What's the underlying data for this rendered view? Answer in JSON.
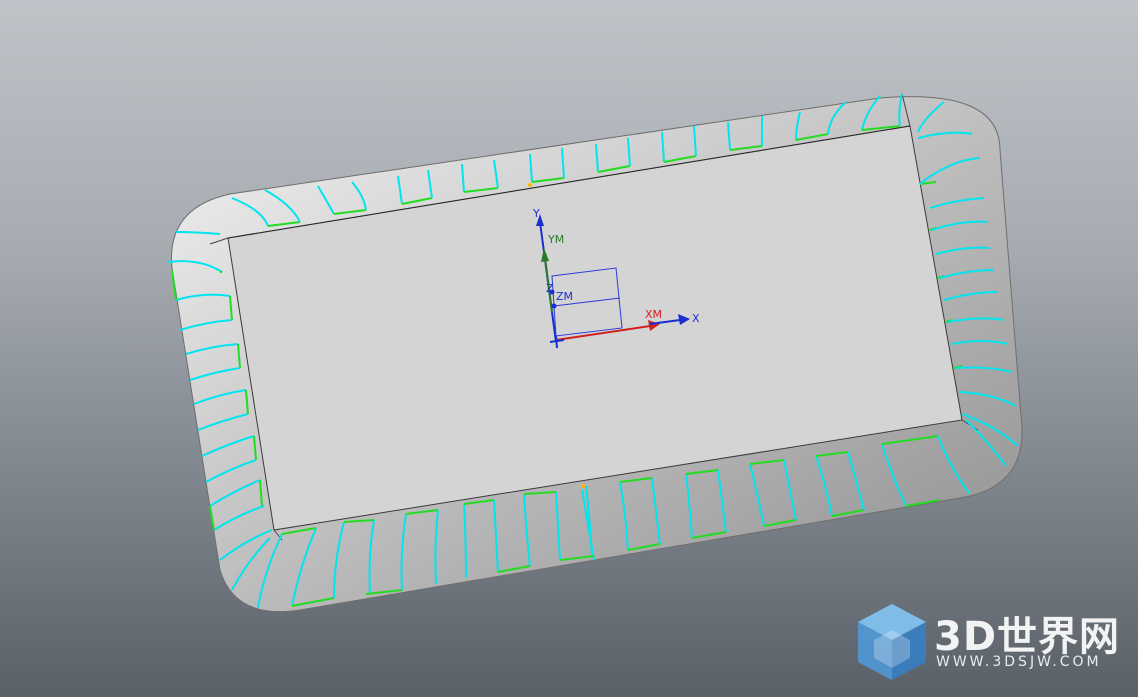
{
  "csys": {
    "y_label": "Y",
    "ym_label": "YM",
    "z_label": "Z",
    "zm_label": "ZM",
    "xm_label": "XM",
    "x_label": "X"
  },
  "watermark": {
    "title": "3D世界网",
    "url": "WWW.3DSJW.COM"
  },
  "colors": {
    "background_top": "#bfc3c8",
    "background_bottom": "#5a6068",
    "part_face": "#d4d4d4",
    "curve_cyan": "#00e5ee",
    "curve_green": "#22dd22",
    "axis_blue": "#1a2fd0",
    "axis_red": "#d02020",
    "axis_green": "#2a7a2a"
  }
}
